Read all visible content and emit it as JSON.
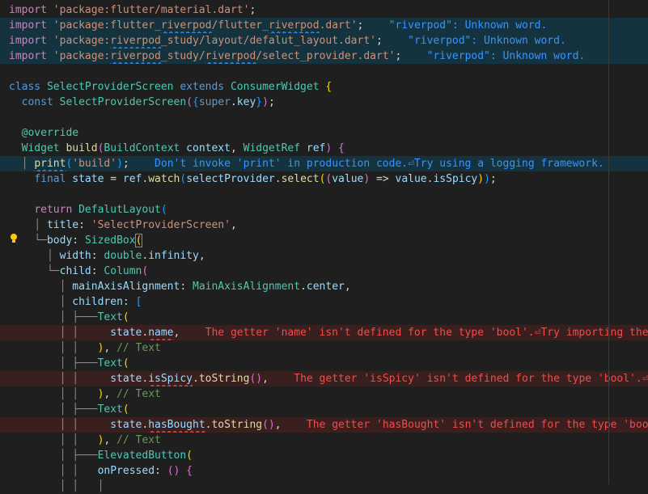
{
  "lines": [
    {
      "type": "normal",
      "tokens": [
        {
          "c": "kw2",
          "t": "import"
        },
        {
          "c": "pl",
          "t": " "
        },
        {
          "c": "str",
          "t": "'package:flutter/material.dart'"
        },
        {
          "c": "pl",
          "t": ";"
        }
      ]
    },
    {
      "type": "info",
      "tokens": [
        {
          "c": "kw2",
          "t": "import"
        },
        {
          "c": "pl",
          "t": " "
        },
        {
          "c": "str",
          "t": "'package:flutter_"
        },
        {
          "c": "str sq-info",
          "t": "riverpod"
        },
        {
          "c": "str",
          "t": "/flutter_"
        },
        {
          "c": "str sq-info",
          "t": "riverpod"
        },
        {
          "c": "str",
          "t": ".dart'"
        },
        {
          "c": "pl",
          "t": ";"
        }
      ],
      "diag": "    \"riverpod\": Unknown word."
    },
    {
      "type": "info",
      "tokens": [
        {
          "c": "kw2",
          "t": "import"
        },
        {
          "c": "pl",
          "t": " "
        },
        {
          "c": "str",
          "t": "'package:"
        },
        {
          "c": "str sq-info",
          "t": "riverpod"
        },
        {
          "c": "str",
          "t": "_study/layout/defalut_layout.dart'"
        },
        {
          "c": "pl",
          "t": ";"
        }
      ],
      "diag": "    \"riverpod\": Unknown word."
    },
    {
      "type": "info",
      "tokens": [
        {
          "c": "kw2",
          "t": "import"
        },
        {
          "c": "pl",
          "t": " "
        },
        {
          "c": "str",
          "t": "'package:"
        },
        {
          "c": "str sq-info",
          "t": "riverpod"
        },
        {
          "c": "str",
          "t": "_study/"
        },
        {
          "c": "str sq-info",
          "t": "riverpod"
        },
        {
          "c": "str",
          "t": "/select_provider.dart'"
        },
        {
          "c": "pl",
          "t": ";"
        }
      ],
      "diag": "    \"riverpod\": Unknown word."
    },
    {
      "type": "normal",
      "tokens": []
    },
    {
      "type": "normal",
      "tokens": [
        {
          "c": "kw",
          "t": "class"
        },
        {
          "c": "pl",
          "t": " "
        },
        {
          "c": "cls",
          "t": "SelectProviderScreen"
        },
        {
          "c": "pl",
          "t": " "
        },
        {
          "c": "kw",
          "t": "extends"
        },
        {
          "c": "pl",
          "t": " "
        },
        {
          "c": "cls",
          "t": "ConsumerWidget"
        },
        {
          "c": "pl",
          "t": " "
        },
        {
          "c": "br1",
          "t": "{"
        }
      ]
    },
    {
      "type": "normal",
      "tokens": [
        {
          "c": "pl",
          "t": "  "
        },
        {
          "c": "kw",
          "t": "const"
        },
        {
          "c": "pl",
          "t": " "
        },
        {
          "c": "cls",
          "t": "SelectProviderScreen"
        },
        {
          "c": "br2",
          "t": "("
        },
        {
          "c": "br3",
          "t": "{"
        },
        {
          "c": "kw",
          "t": "super"
        },
        {
          "c": "pl",
          "t": "."
        },
        {
          "c": "var",
          "t": "key"
        },
        {
          "c": "br3",
          "t": "}"
        },
        {
          "c": "br2",
          "t": ")"
        },
        {
          "c": "pl",
          "t": ";"
        }
      ]
    },
    {
      "type": "normal",
      "tokens": []
    },
    {
      "type": "normal",
      "tokens": [
        {
          "c": "pl",
          "t": "  "
        },
        {
          "c": "cls",
          "t": "@override"
        }
      ]
    },
    {
      "type": "normal",
      "tokens": [
        {
          "c": "pl",
          "t": "  "
        },
        {
          "c": "cls",
          "t": "Widget"
        },
        {
          "c": "pl",
          "t": " "
        },
        {
          "c": "fn",
          "t": "build"
        },
        {
          "c": "br2",
          "t": "("
        },
        {
          "c": "cls",
          "t": "BuildContext"
        },
        {
          "c": "pl",
          "t": " "
        },
        {
          "c": "var",
          "t": "context"
        },
        {
          "c": "pl",
          "t": ", "
        },
        {
          "c": "cls",
          "t": "WidgetRef"
        },
        {
          "c": "pl",
          "t": " "
        },
        {
          "c": "var",
          "t": "ref"
        },
        {
          "c": "br2",
          "t": ")"
        },
        {
          "c": "pl",
          "t": " "
        },
        {
          "c": "br2",
          "t": "{"
        }
      ]
    },
    {
      "type": "info",
      "tokens": [
        {
          "c": "tree",
          "t": "  │ "
        },
        {
          "c": "fn sq-info",
          "t": "print"
        },
        {
          "c": "br3",
          "t": "("
        },
        {
          "c": "str",
          "t": "'build'"
        },
        {
          "c": "br3",
          "t": ")"
        },
        {
          "c": "pl",
          "t": ";"
        }
      ],
      "diag": "    Don't invoke 'print' in production code.⏎Try using a logging framework."
    },
    {
      "type": "normal",
      "tokens": [
        {
          "c": "pl",
          "t": "    "
        },
        {
          "c": "kw",
          "t": "final"
        },
        {
          "c": "pl",
          "t": " "
        },
        {
          "c": "var",
          "t": "state"
        },
        {
          "c": "pl",
          "t": " = "
        },
        {
          "c": "var",
          "t": "ref"
        },
        {
          "c": "pl",
          "t": "."
        },
        {
          "c": "fn",
          "t": "watch"
        },
        {
          "c": "br3",
          "t": "("
        },
        {
          "c": "var",
          "t": "selectProvider"
        },
        {
          "c": "pl",
          "t": "."
        },
        {
          "c": "fn",
          "t": "select"
        },
        {
          "c": "br1",
          "t": "("
        },
        {
          "c": "br2",
          "t": "("
        },
        {
          "c": "var",
          "t": "value"
        },
        {
          "c": "br2",
          "t": ")"
        },
        {
          "c": "pl",
          "t": " => "
        },
        {
          "c": "var",
          "t": "value"
        },
        {
          "c": "pl",
          "t": "."
        },
        {
          "c": "var",
          "t": "isSpicy"
        },
        {
          "c": "br1",
          "t": ")"
        },
        {
          "c": "br3",
          "t": ")"
        },
        {
          "c": "pl",
          "t": ";"
        }
      ]
    },
    {
      "type": "normal",
      "tokens": []
    },
    {
      "type": "normal",
      "tokens": [
        {
          "c": "pl",
          "t": "    "
        },
        {
          "c": "kw2",
          "t": "return"
        },
        {
          "c": "pl",
          "t": " "
        },
        {
          "c": "cls",
          "t": "DefalutLayout"
        },
        {
          "c": "br3",
          "t": "("
        }
      ]
    },
    {
      "type": "normal",
      "tokens": [
        {
          "c": "tree",
          "t": "    │ "
        },
        {
          "c": "var",
          "t": "title"
        },
        {
          "c": "pl",
          "t": ": "
        },
        {
          "c": "str",
          "t": "'SelectProviderScreen'"
        },
        {
          "c": "pl",
          "t": ","
        }
      ]
    },
    {
      "type": "normal",
      "tokens": [
        {
          "c": "tree",
          "t": "    └─"
        },
        {
          "c": "var",
          "t": "body"
        },
        {
          "c": "pl",
          "t": ": "
        },
        {
          "c": "cls",
          "t": "SizedBox"
        },
        {
          "c": "br1 bracket-box",
          "t": "("
        }
      ]
    },
    {
      "type": "normal",
      "tokens": [
        {
          "c": "tree",
          "t": "      │ "
        },
        {
          "c": "var",
          "t": "width"
        },
        {
          "c": "pl",
          "t": ": "
        },
        {
          "c": "cls",
          "t": "double"
        },
        {
          "c": "pl",
          "t": "."
        },
        {
          "c": "var",
          "t": "infinity"
        },
        {
          "c": "pl",
          "t": ","
        }
      ]
    },
    {
      "type": "normal",
      "tokens": [
        {
          "c": "tree",
          "t": "      └─"
        },
        {
          "c": "var",
          "t": "child"
        },
        {
          "c": "pl",
          "t": ": "
        },
        {
          "c": "cls",
          "t": "Column"
        },
        {
          "c": "br2",
          "t": "("
        }
      ]
    },
    {
      "type": "normal",
      "tokens": [
        {
          "c": "tree",
          "t": "        │ "
        },
        {
          "c": "var",
          "t": "mainAxisAlignment"
        },
        {
          "c": "pl",
          "t": ": "
        },
        {
          "c": "cls",
          "t": "MainAxisAlignment"
        },
        {
          "c": "pl",
          "t": "."
        },
        {
          "c": "var",
          "t": "center"
        },
        {
          "c": "pl",
          "t": ","
        }
      ]
    },
    {
      "type": "normal",
      "tokens": [
        {
          "c": "tree",
          "t": "        │ "
        },
        {
          "c": "var",
          "t": "children"
        },
        {
          "c": "pl",
          "t": ": "
        },
        {
          "c": "br3",
          "t": "["
        }
      ]
    },
    {
      "type": "normal",
      "tokens": [
        {
          "c": "tree",
          "t": "        │ ├───"
        },
        {
          "c": "cls",
          "t": "Text"
        },
        {
          "c": "br1",
          "t": "("
        }
      ]
    },
    {
      "type": "err",
      "tokens": [
        {
          "c": "tree",
          "t": "        │ │     "
        },
        {
          "c": "var",
          "t": "state"
        },
        {
          "c": "pl",
          "t": "."
        },
        {
          "c": "var sq-err",
          "t": "name"
        },
        {
          "c": "pl",
          "t": ","
        }
      ],
      "diag": "    The getter 'name' isn't defined for the type 'bool'.⏎Try importing the library"
    },
    {
      "type": "normal",
      "tokens": [
        {
          "c": "tree",
          "t": "        │ │   "
        },
        {
          "c": "br1",
          "t": ")"
        },
        {
          "c": "pl",
          "t": ", "
        },
        {
          "c": "cm",
          "t": "// Text"
        }
      ]
    },
    {
      "type": "normal",
      "tokens": [
        {
          "c": "tree",
          "t": "        │ ├───"
        },
        {
          "c": "cls",
          "t": "Text"
        },
        {
          "c": "br1",
          "t": "("
        }
      ]
    },
    {
      "type": "err",
      "tokens": [
        {
          "c": "tree",
          "t": "        │ │     "
        },
        {
          "c": "var",
          "t": "state"
        },
        {
          "c": "pl",
          "t": "."
        },
        {
          "c": "var sq-err",
          "t": "isSpicy"
        },
        {
          "c": "pl",
          "t": "."
        },
        {
          "c": "fn",
          "t": "toString"
        },
        {
          "c": "br2",
          "t": "()"
        },
        {
          "c": "pl",
          "t": ","
        }
      ],
      "diag": "    The getter 'isSpicy' isn't defined for the type 'bool'.⏎Try"
    },
    {
      "type": "normal",
      "tokens": [
        {
          "c": "tree",
          "t": "        │ │   "
        },
        {
          "c": "br1",
          "t": ")"
        },
        {
          "c": "pl",
          "t": ", "
        },
        {
          "c": "cm",
          "t": "// Text"
        }
      ]
    },
    {
      "type": "normal",
      "tokens": [
        {
          "c": "tree",
          "t": "        │ ├───"
        },
        {
          "c": "cls",
          "t": "Text"
        },
        {
          "c": "br1",
          "t": "("
        }
      ]
    },
    {
      "type": "err",
      "tokens": [
        {
          "c": "tree",
          "t": "        │ │     "
        },
        {
          "c": "var",
          "t": "state"
        },
        {
          "c": "pl",
          "t": "."
        },
        {
          "c": "var sq-err",
          "t": "hasBought"
        },
        {
          "c": "pl",
          "t": "."
        },
        {
          "c": "fn",
          "t": "toString"
        },
        {
          "c": "br2",
          "t": "()"
        },
        {
          "c": "pl",
          "t": ","
        }
      ],
      "diag": "    The getter 'hasBought' isn't defined for the type 'bool'.⏎"
    },
    {
      "type": "normal",
      "tokens": [
        {
          "c": "tree",
          "t": "        │ │   "
        },
        {
          "c": "br1",
          "t": ")"
        },
        {
          "c": "pl",
          "t": ", "
        },
        {
          "c": "cm",
          "t": "// Text"
        }
      ]
    },
    {
      "type": "normal",
      "tokens": [
        {
          "c": "tree",
          "t": "        │ ├───"
        },
        {
          "c": "cls",
          "t": "ElevatedButton"
        },
        {
          "c": "br1",
          "t": "("
        }
      ]
    },
    {
      "type": "normal",
      "tokens": [
        {
          "c": "tree",
          "t": "        │ │   "
        },
        {
          "c": "var",
          "t": "onPressed"
        },
        {
          "c": "pl",
          "t": ": "
        },
        {
          "c": "br2",
          "t": "()"
        },
        {
          "c": "pl",
          "t": " "
        },
        {
          "c": "br2",
          "t": "{"
        }
      ]
    },
    {
      "type": "normal",
      "tokens": [
        {
          "c": "tree",
          "t": "        │ │   │ "
        }
      ]
    }
  ],
  "colors": {
    "background": "#1f1f1f",
    "info_line": "#15333e",
    "error_line": "#3a1f1f",
    "info_text": "#3794ff",
    "error_text": "#f14c4c"
  },
  "icons": {
    "lightbulb": "lightbulb-icon"
  }
}
